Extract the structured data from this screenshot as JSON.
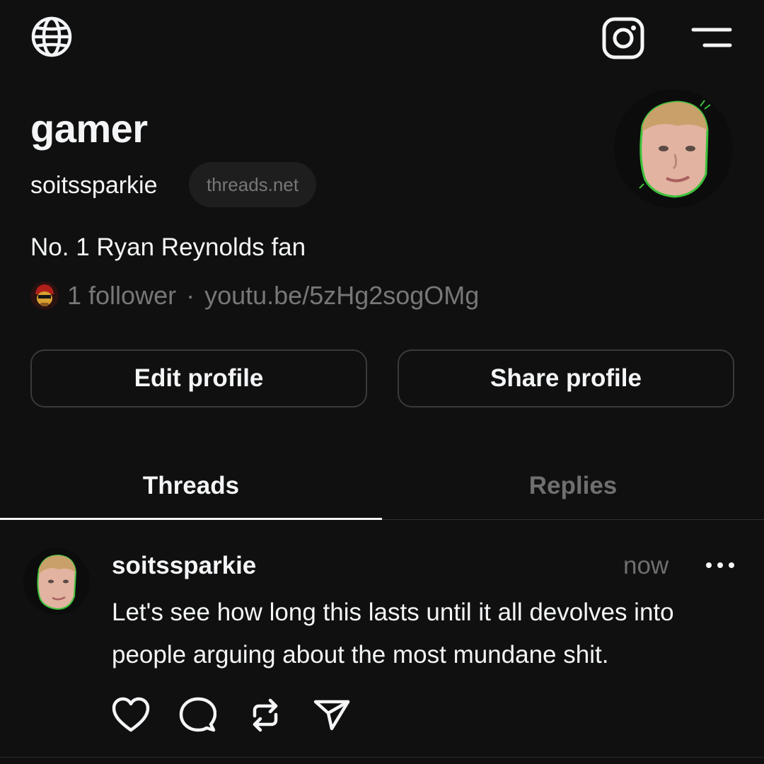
{
  "colors": {
    "background": "#101010",
    "text_primary": "#f3f5f7",
    "text_secondary": "#777777",
    "button_border": "#3a3a3a",
    "pill_background": "#1e1e1e"
  },
  "top_bar": {
    "left_icon": "globe-icon",
    "right_icons": [
      "instagram-icon",
      "menu-icon"
    ]
  },
  "profile": {
    "display_name": "gamer",
    "username": "soitssparkie",
    "domain_badge": "threads.net",
    "bio": "No. 1 Ryan Reynolds fan",
    "followers_text": "1 follower",
    "separator": "·",
    "link": "youtu.be/5zHg2sogOMg"
  },
  "buttons": {
    "edit_label": "Edit profile",
    "share_label": "Share profile"
  },
  "tabs": [
    {
      "label": "Threads",
      "active": true
    },
    {
      "label": "Replies",
      "active": false
    }
  ],
  "post": {
    "username": "soitssparkie",
    "time": "now",
    "text": "Let's see how long this lasts until it all devolves into people arguing about the most mundane shit.",
    "actions": [
      "heart-icon",
      "comment-icon",
      "repost-icon",
      "send-icon"
    ]
  }
}
